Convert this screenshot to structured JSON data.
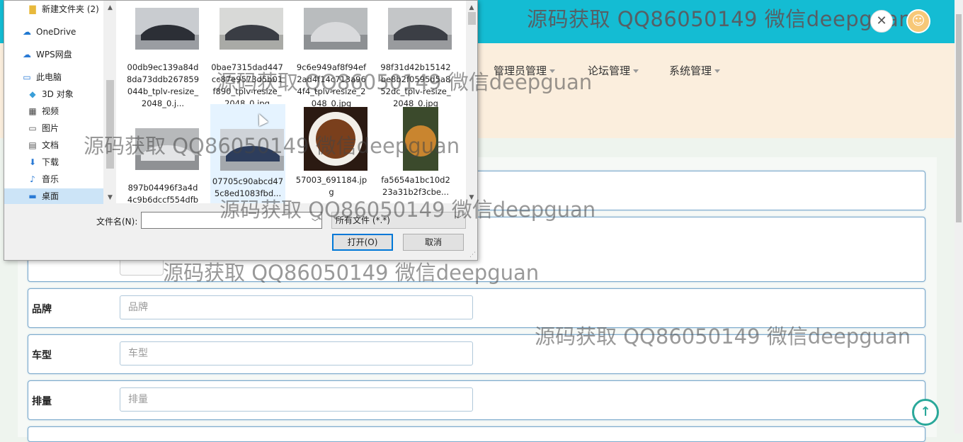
{
  "header": {
    "watermark": "源码获取 QQ86050149 微信deepguan",
    "close_icon": "close-icon",
    "avatar_icon": "user-avatar-icon"
  },
  "nav": {
    "items": [
      {
        "label": "管理员管理"
      },
      {
        "label": "论坛管理"
      },
      {
        "label": "系统管理"
      }
    ]
  },
  "form": {
    "rows": [
      {
        "label": "品牌",
        "placeholder": "品牌"
      },
      {
        "label": "车型",
        "placeholder": "车型"
      },
      {
        "label": "排量",
        "placeholder": "排量"
      }
    ]
  },
  "watermarks": [
    "源码获取 QQ86050149 微信deepguan",
    "源码获取 QQ86050149 微信deepguan",
    "源码获取 QQ86050149 微信deepguan",
    "源码获取 QQ86050149 微信deepguan",
    "源码获取 QQ86050149 微信deepguan"
  ],
  "file_dialog": {
    "nav_items": [
      {
        "label": "新建文件夹 (2)",
        "icon": "folder-icon"
      },
      {
        "label": "OneDrive",
        "icon": "cloud-icon"
      },
      {
        "label": "WPS网盘",
        "icon": "cloud-icon"
      },
      {
        "label": "此电脑",
        "icon": "computer-icon"
      },
      {
        "label": "3D 对象",
        "icon": "cube-icon"
      },
      {
        "label": "视频",
        "icon": "video-icon"
      },
      {
        "label": "图片",
        "icon": "picture-icon"
      },
      {
        "label": "文档",
        "icon": "document-icon"
      },
      {
        "label": "下载",
        "icon": "download-icon"
      },
      {
        "label": "音乐",
        "icon": "music-icon"
      },
      {
        "label": "桌面",
        "icon": "desktop-icon"
      }
    ],
    "files": [
      {
        "name": "00db9ec139a84d8da73ddb267859044b_tplv-resize_2048_0.j...",
        "color": "#2c2f36"
      },
      {
        "name": "0bae7315dad447cc87e9573d5b01f890_tplv-resize_2048_0.jpg",
        "color": "#3a3d44"
      },
      {
        "name": "9c6e949af8f94ef2ad4f14c713a964f4_tplv-resize_2048_0.jpg",
        "color": "#d9dadc"
      },
      {
        "name": "98f31d42b15142be8b2f0595d5a852dc_tplv-resize_2048_0.jpg",
        "color": "#3b3e45"
      },
      {
        "name": "897b04496f3a4d4c9b6dccf554dfbb48_tplv-res...",
        "color": "#e3e4e6"
      },
      {
        "name": "07705c90abcd475c8ed1083fbd...",
        "color": "#2d3d5c"
      },
      {
        "name": "57003_691184.jpg",
        "color": "#7a3f1c"
      },
      {
        "name": "fa5654a1bc10d223a31b2f3cbe...",
        "color": "#c9852f"
      }
    ],
    "filename_label": "文件名(N):",
    "filename_value": "",
    "filter_value": "所有文件 (*.*)",
    "open_label": "打开(O)",
    "cancel_label": "取消"
  }
}
